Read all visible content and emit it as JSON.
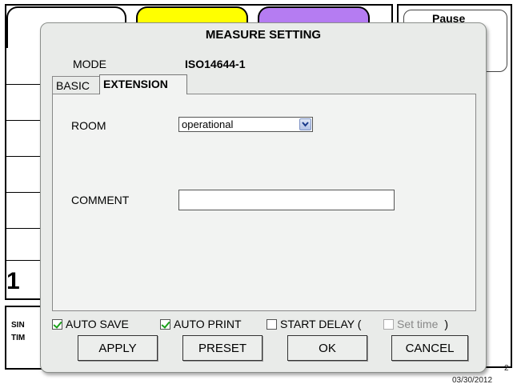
{
  "background": {
    "big_number": "1",
    "bottom_label_1": "SIN",
    "bottom_label_2": "TIM",
    "pause_button": "Pause",
    "date": "03/30/2012",
    "date_partial": "2"
  },
  "dialog": {
    "title": "MEASURE SETTING",
    "mode_label": "MODE",
    "mode_value": "ISO14644-1",
    "tabs": [
      {
        "label": "BASIC",
        "active": false
      },
      {
        "label": "EXTENSION",
        "active": true
      }
    ],
    "room": {
      "label": "ROOM",
      "selected": "operational"
    },
    "comment": {
      "label": "COMMENT",
      "value": ""
    },
    "options": {
      "auto_save": {
        "label": "AUTO SAVE",
        "checked": true
      },
      "auto_print": {
        "label": "AUTO PRINT",
        "checked": true
      },
      "start_delay": {
        "label": "START DELAY (",
        "checked": false
      },
      "set_time": {
        "label": "Set time",
        "checked": false,
        "close": ")"
      }
    },
    "buttons": {
      "apply": "APPLY",
      "preset": "PRESET",
      "ok": "OK",
      "cancel": "CANCEL"
    }
  },
  "colors": {
    "tab_yellow": "#ffff00",
    "tab_purple": "#b57cf2",
    "checkmark_green": "#19a019"
  }
}
